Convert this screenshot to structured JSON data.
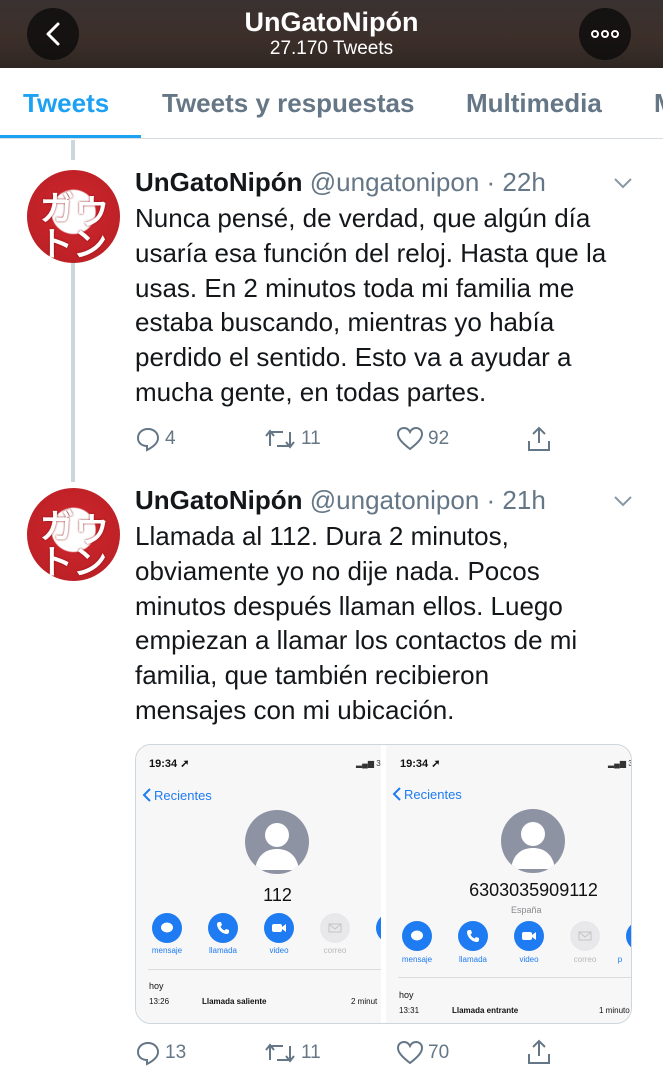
{
  "header": {
    "title": "UnGatoNipón",
    "subtitle": "27.170 Tweets",
    "back_icon": "chevron-left-icon",
    "more_icon": "more-dots-icon"
  },
  "tabs": [
    {
      "label": "Tweets",
      "active": true
    },
    {
      "label": "Tweets y respuestas",
      "active": false
    },
    {
      "label": "Multimedia",
      "active": false
    },
    {
      "label": "M",
      "active": false
    }
  ],
  "avatar_text": [
    "ガ",
    "ウ",
    "ト",
    "ン"
  ],
  "tweets": [
    {
      "name": "UnGatoNipón",
      "handle": "@ungatonipon",
      "time": "· 22h",
      "text_lines": [
        "Nunca pensé, de verdad, que algún día",
        "usaría esa función del reloj. Hasta que la",
        "usas. En 2 minutos toda mi familia me",
        "estaba buscando, mientras yo había",
        "perdido el sentido. Esto va a ayudar a",
        "mucha gente, en todas partes."
      ],
      "replies": "4",
      "retweets": "11",
      "likes": "92"
    },
    {
      "name": "UnGatoNipón",
      "handle": "@ungatonipon",
      "time": "· 21h",
      "text_lines": [
        "Llamada al 112. Dura 2 minutos,",
        "obviamente yo no dije nada. Pocos",
        "minutos después llaman ellos. Luego",
        "empiezan a llamar los contactos de mi",
        "familia, que también recibieron",
        "mensajes con mi ubicación."
      ],
      "replies": "13",
      "retweets": "11",
      "likes": "70"
    }
  ],
  "media": {
    "left": {
      "time": "19:34",
      "signal": "3",
      "back": "Recientes",
      "number": "112",
      "actions": [
        "mensaje",
        "llamada",
        "video",
        "correo"
      ],
      "day": "hoy",
      "call_time": "13:26",
      "call_type": "Llamada saliente",
      "duration": "2 minut"
    },
    "right": {
      "time": "19:34",
      "signal": "3",
      "back": "Recientes",
      "number": "6303035909112",
      "country": "España",
      "actions": [
        "mensaje",
        "llamada",
        "video",
        "correo",
        "p"
      ],
      "day": "hoy",
      "call_time": "13:31",
      "call_type": "Llamada entrante",
      "duration": "1 minuto"
    }
  },
  "colors": {
    "accent": "#1da1f2",
    "muted": "#657786",
    "ios_blue": "#1e7bf2",
    "avatar_red": "#c7242a"
  }
}
